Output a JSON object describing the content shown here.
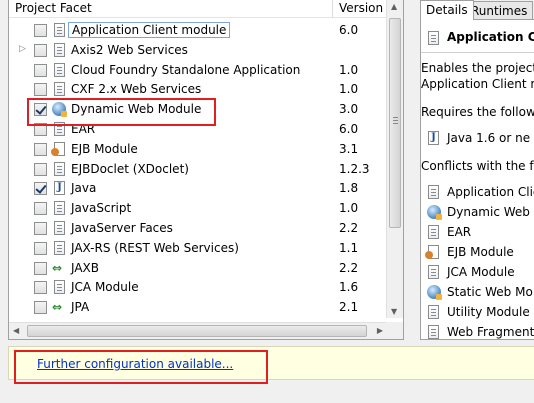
{
  "table": {
    "col_facet": "Project Facet",
    "col_version": "Version",
    "rows": [
      {
        "label": "Application Client module",
        "version": "6.0",
        "checked": false,
        "icon": "doc"
      },
      {
        "label": "Axis2 Web Services",
        "version": "",
        "checked": false,
        "icon": "doc",
        "expandable": true
      },
      {
        "label": "Cloud Foundry Standalone Application",
        "version": "1.0",
        "checked": false,
        "icon": "doc"
      },
      {
        "label": "CXF 2.x Web Services",
        "version": "1.0",
        "checked": false,
        "icon": "doc"
      },
      {
        "label": "Dynamic Web Module",
        "version": "3.0",
        "checked": true,
        "icon": "globe"
      },
      {
        "label": "EAR",
        "version": "6.0",
        "checked": false,
        "icon": "doc"
      },
      {
        "label": "EJB Module",
        "version": "3.1",
        "checked": false,
        "icon": "bean"
      },
      {
        "label": "EJBDoclet (XDoclet)",
        "version": "1.2.3",
        "checked": false,
        "icon": "doc"
      },
      {
        "label": "Java",
        "version": "1.8",
        "checked": true,
        "icon": "java"
      },
      {
        "label": "JavaScript",
        "version": "1.0",
        "checked": false,
        "icon": "doc"
      },
      {
        "label": "JavaServer Faces",
        "version": "2.2",
        "checked": false,
        "icon": "doc"
      },
      {
        "label": "JAX-RS (REST Web Services)",
        "version": "1.1",
        "checked": false,
        "icon": "doc"
      },
      {
        "label": "JAXB",
        "version": "2.2",
        "checked": false,
        "icon": "arrows"
      },
      {
        "label": "JCA Module",
        "version": "1.6",
        "checked": false,
        "icon": "doc"
      },
      {
        "label": "JPA",
        "version": "2.1",
        "checked": false,
        "icon": "arrows"
      }
    ]
  },
  "details": {
    "tab_details": "Details",
    "tab_runtimes": "Runtimes",
    "title": "Application Clie",
    "desc_line1": "Enables the project",
    "desc_line2": "Application Client m",
    "requires": "Requires the followi",
    "requires_item": "Java 1.6 or ne",
    "conflicts": "Conflicts with the fo",
    "conflict_items": [
      {
        "label": "Application Clie",
        "icon": "doc"
      },
      {
        "label": "Dynamic Web M",
        "icon": "globe"
      },
      {
        "label": "EAR",
        "icon": "doc"
      },
      {
        "label": "EJB Module",
        "icon": "bean"
      },
      {
        "label": "JCA Module",
        "icon": "doc"
      },
      {
        "label": "Static Web Mo",
        "icon": "globe"
      },
      {
        "label": "Utility Module",
        "icon": "doc"
      },
      {
        "label": "Web Fragment",
        "icon": "doc"
      }
    ]
  },
  "config": {
    "link_text": "Further configuration available..."
  },
  "colors": {
    "highlight": "#e02020",
    "link": "#0033cc",
    "info_bar": "#ffffe1"
  }
}
